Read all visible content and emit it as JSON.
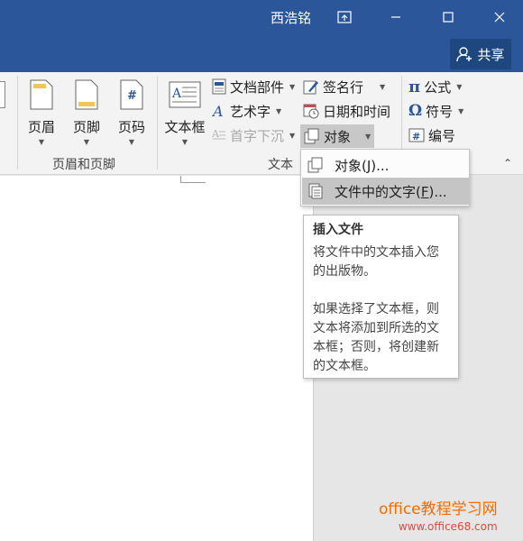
{
  "titlebar": {
    "user": "西浩铭",
    "share_label": "共享"
  },
  "ribbon": {
    "header_footer": {
      "header": "页眉",
      "footer": "页脚",
      "page_number": "页码",
      "group_label": "页眉和页脚"
    },
    "text": {
      "textbox": "文本框",
      "quick_parts": "文档部件",
      "wordart": "艺术字",
      "drop_cap": "首字下沉",
      "signature_line": "签名行",
      "date_time": "日期和时间",
      "object": "对象",
      "group_label": "文本"
    },
    "symbols": {
      "equation": "公式",
      "symbol": "符号",
      "numbering": "编号"
    }
  },
  "menu": {
    "items": [
      {
        "label_pre": "对象(",
        "hotkey": "J",
        "label_post": ")..."
      },
      {
        "label_pre": "文件中的文字(",
        "hotkey": "F",
        "label_post": ")..."
      }
    ]
  },
  "tooltip": {
    "title": "插入文件",
    "para1": "将文件中的文本插入您的出版物。",
    "para2": "如果选择了文本框，则文本将添加到所选的文本框；否则，将创建新的文本框。"
  },
  "watermark": {
    "line1": "office教程学习网",
    "line2": "www.office68.com"
  },
  "colors": {
    "titlebar": "#2b579a",
    "share_button": "#1e467f",
    "watermark": "#f26d00"
  }
}
